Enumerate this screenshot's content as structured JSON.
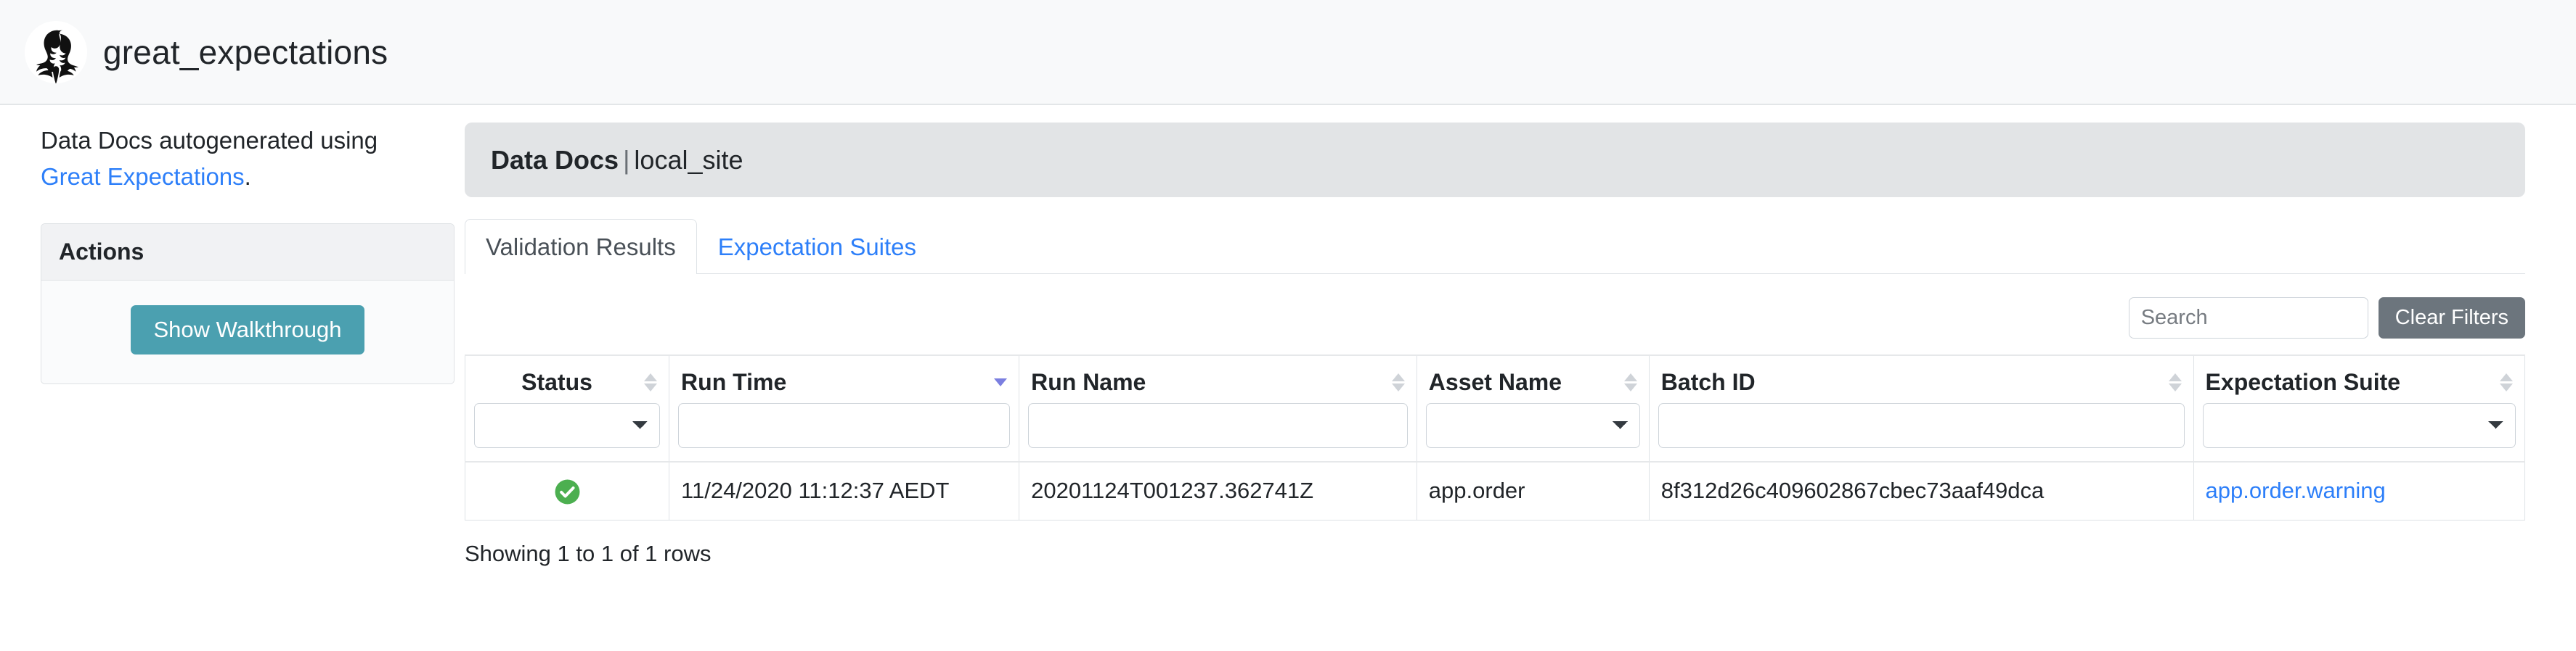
{
  "navbar": {
    "brand_title": "great_expectations",
    "logo_alt": "great-expectations-logo"
  },
  "sidebar": {
    "intro_prefix": "Data Docs autogenerated using ",
    "intro_link": "Great Expectations",
    "intro_suffix": ".",
    "actions_card": {
      "header": "Actions",
      "walkthrough_button": "Show Walkthrough"
    }
  },
  "main": {
    "jumbotron": {
      "title": "Data Docs",
      "separator": "|",
      "site": "local_site"
    },
    "tabs": [
      {
        "label": "Validation Results",
        "active": true
      },
      {
        "label": "Expectation Suites",
        "active": false
      }
    ],
    "toolbar": {
      "search_placeholder": "Search",
      "search_value": "",
      "clear_filters_label": "Clear Filters"
    },
    "table": {
      "columns": [
        {
          "label": "Status",
          "sort": "none",
          "filter": "select"
        },
        {
          "label": "Run Time",
          "sort": "desc",
          "filter": "text"
        },
        {
          "label": "Run Name",
          "sort": "none",
          "filter": "text"
        },
        {
          "label": "Asset Name",
          "sort": "none",
          "filter": "select"
        },
        {
          "label": "Batch ID",
          "sort": "none",
          "filter": "text"
        },
        {
          "label": "Expectation Suite",
          "sort": "none",
          "filter": "select"
        }
      ],
      "filters": {
        "status": "",
        "run_time": "",
        "run_name": "",
        "asset_name": "",
        "batch_id": "",
        "expectation_suite": ""
      },
      "rows": [
        {
          "status": "success",
          "status_icon": "check-circle-icon",
          "run_time": "11/24/2020 11:12:37 AEDT",
          "run_name": "20201124T001237.362741Z",
          "asset_name": "app.order",
          "batch_id": "8f312d26c409602867cbec73aaf49dca",
          "expectation_suite": "app.order.warning"
        }
      ],
      "showing": "Showing 1 to 1 of 1 rows"
    }
  },
  "colors": {
    "link": "#2d7ff9",
    "walkthrough_button": "#4ba0b0",
    "clear_filters_button": "#6c757d",
    "status_success": "#4caf50",
    "navbar_background": "#f8f9fa",
    "jumbotron_background": "#e2e4e6",
    "sort_active": "#7b7fe0"
  }
}
